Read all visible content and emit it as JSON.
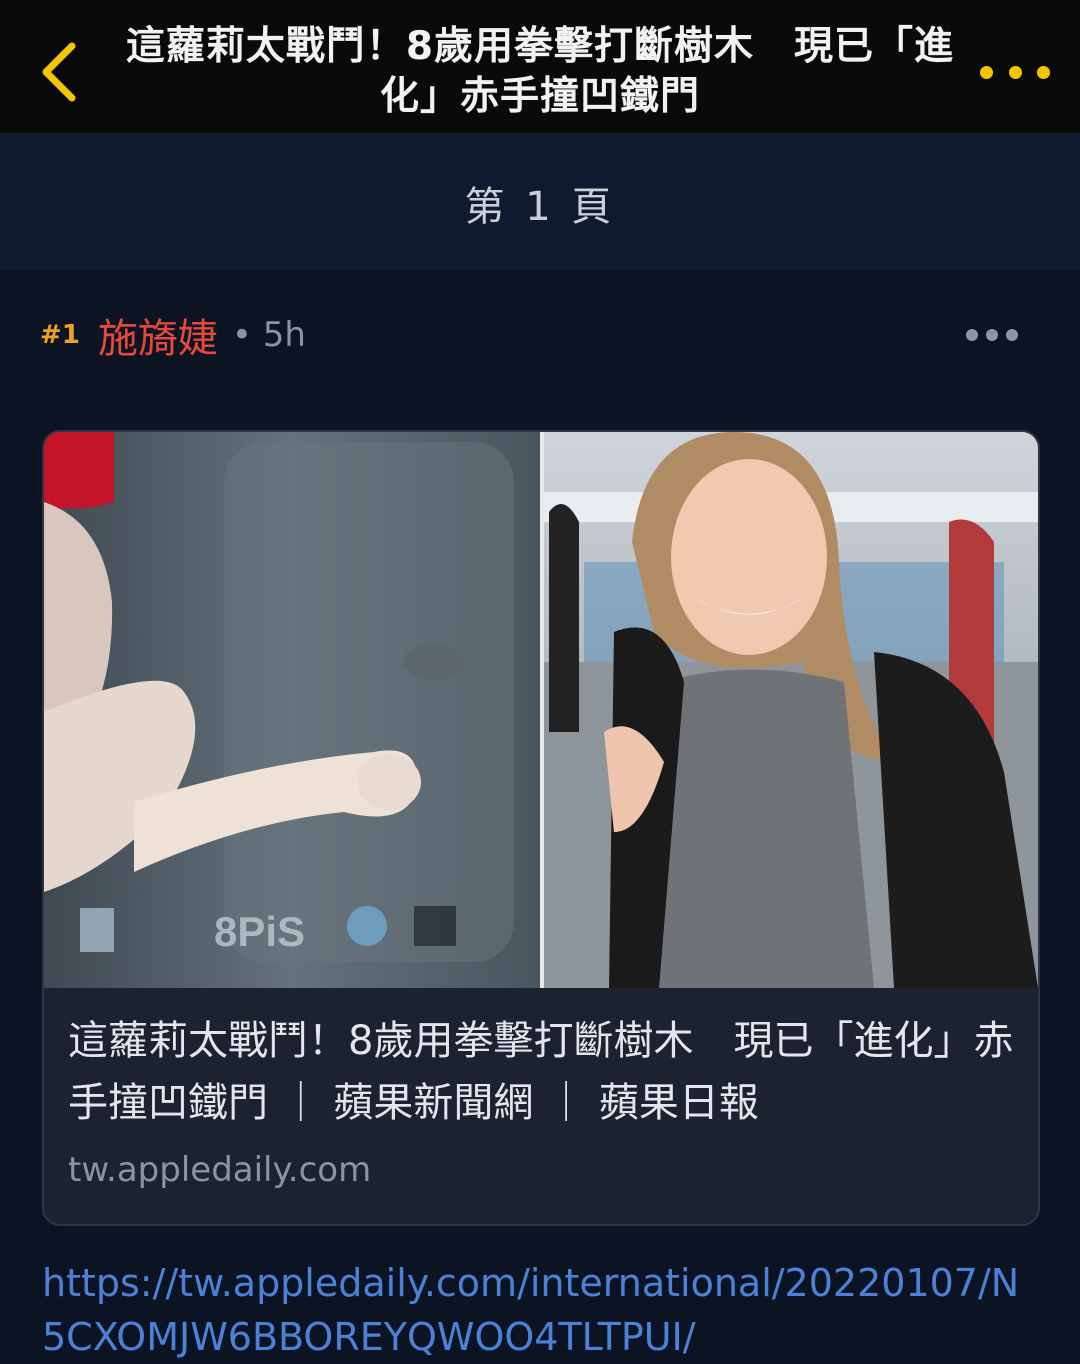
{
  "topbar": {
    "title": "這蘿莉太戰鬥！8歲用拳擊打斷樹木　現已「進化」赤手撞凹鐵門",
    "back_icon": "chevron-left-icon",
    "more_icon": "more-horizontal-icon",
    "accent_color": "#f5c400"
  },
  "page_indicator": "第 1 頁",
  "post": {
    "floor": "#1",
    "author": "施旖婕",
    "time_ago": "• 5h",
    "author_color": "#e5493c",
    "floor_color": "#f0a21c"
  },
  "link_card": {
    "title": "這蘿莉太戰鬥！8歲用拳擊打斷樹木　現已「進化」赤手撞凹鐵門 ｜ 蘋果新聞網 ｜ 蘋果日報",
    "domain": "tw.appledaily.com",
    "preview_logo_text": "8PiS"
  },
  "link_url": "https://tw.appledaily.com/international/20220107/N5CXOMJW6BBOREYQWOO4TLTPUI/",
  "link_color": "#4b82d8"
}
